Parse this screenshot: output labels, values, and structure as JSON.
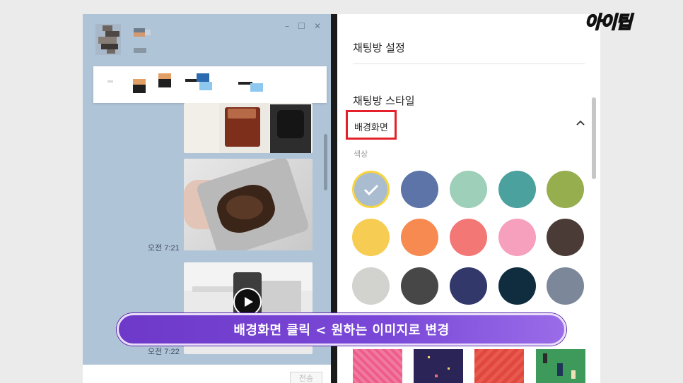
{
  "logo": {
    "text": "아이팁"
  },
  "chat_window": {
    "controls": {
      "minimize": "–",
      "maximize": "☐",
      "close": "✕"
    },
    "messages": [
      {
        "type": "photo",
        "subject": "iced coffee and grinder"
      },
      {
        "type": "photo",
        "subject": "coffee grounds in blender",
        "time": "오전 7:21"
      },
      {
        "type": "video",
        "subject": "grinder video",
        "time": "오전 7:22"
      }
    ],
    "send_label": "전송"
  },
  "settings": {
    "title": "채팅방 설정",
    "style_title": "채팅방 스타일",
    "background_section": {
      "label": "배경화면",
      "expanded": true
    },
    "color_label": "색상",
    "colors": [
      "#aabdd0",
      "#5c74a8",
      "#9ecfb8",
      "#4aa19e",
      "#97ae4f",
      "#f6cc52",
      "#f78a50",
      "#f27775",
      "#f6a0bd",
      "#4a3b36",
      "#d2d3cf",
      "#474747",
      "#33386b",
      "#0f2d3e",
      "#7c8799"
    ],
    "selected_color_index": 0,
    "thumbnails": [
      "pink pattern",
      "navy stars",
      "red pattern",
      "green game"
    ]
  },
  "caption": {
    "text": "배경화면 클릭 < 원하는 이미지로 변경"
  },
  "colors": {
    "chat_bg": "#b0c4d8",
    "highlight": "#e4202a",
    "caption_purple": "#7a48d8",
    "selected_ring": "#f7d440"
  }
}
